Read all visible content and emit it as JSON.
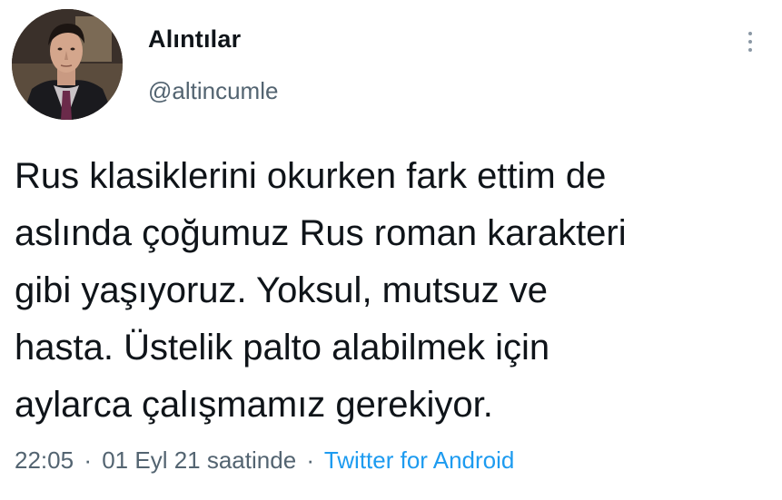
{
  "user": {
    "display_name": "Alıntılar",
    "handle": "@altincumle"
  },
  "tweet": {
    "lines": [
      "Rus klasiklerini okurken fark ettim de",
      "aslında çoğumuz Rus roman karakteri",
      "gibi yaşıyoruz. Yoksul, mutsuz ve",
      "hasta. Üstelik palto alabilmek için",
      "aylarca çalışmamız gerekiyor."
    ]
  },
  "meta": {
    "time": "22:05",
    "separator": "·",
    "date": "01 Eyl 21 saatinde",
    "source": "Twitter for Android"
  },
  "icons": {
    "more": "more-vertical-icon"
  },
  "colors": {
    "text": "#0f1419",
    "secondary": "#536471",
    "link": "#1d9bf0"
  }
}
